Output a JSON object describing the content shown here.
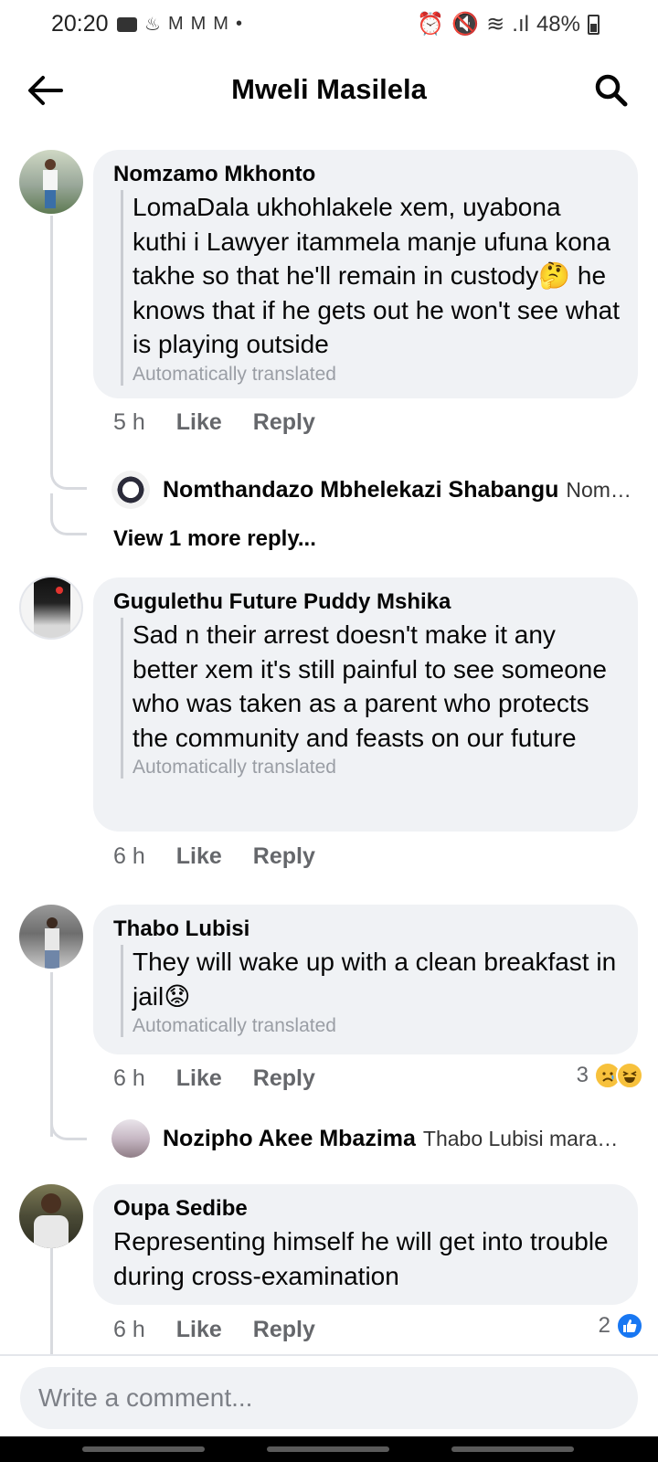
{
  "status_bar": {
    "time": "20:20",
    "battery": "48%"
  },
  "header": {
    "title": "Mweli Masilela"
  },
  "comments": [
    {
      "author": "Nomzamo Mkhonto",
      "text": "LomaDala ukhohlakele xem, uyabona kuthi i Lawyer itammela manje ufuna kona takhe so that he'll remain in custody🤔 he knows that if he gets out he won't see what is playing outside",
      "translated_note": "Automatically translated",
      "time": "5 h",
      "like": "Like",
      "reply": "Reply",
      "replies": [
        {
          "name": "Nomthandazo Mbhelekazi Shabangu",
          "preview": "Nom…"
        }
      ],
      "view_more": "View 1 more reply..."
    },
    {
      "author": "Gugulethu Future Puddy Mshika",
      "text": "Sad n their arrest doesn't make it any better xem it's still painful to see someone who was taken as a parent who protects the community and feasts on our future",
      "translated_note": "Automatically translated",
      "time": "6 h",
      "like": "Like",
      "reply": "Reply"
    },
    {
      "author": "Thabo Lubisi",
      "text": "They will wake up with a clean breakfast in jail😟",
      "translated_note": "Automatically translated",
      "time": "6 h",
      "like": "Like",
      "reply": "Reply",
      "reaction_count": "3",
      "reaction_icons": [
        "sad-face-icon",
        "haha-face-icon"
      ],
      "replies": [
        {
          "name": "Nozipho Akee Mbazima",
          "preview": "Thabo Lubisi mara…"
        }
      ]
    },
    {
      "author": "Oupa Sedibe",
      "text": "Representing himself he will get into trouble during cross-examination",
      "time": "6 h",
      "like": "Like",
      "reply": "Reply",
      "reaction_count": "2",
      "reaction_icons": [
        "like-thumb-icon"
      ]
    }
  ],
  "composer": {
    "placeholder": "Write a comment..."
  },
  "colors": {
    "bubble": "#f0f2f5",
    "meta_text": "#65676b",
    "like_blue": "#1877f2"
  }
}
